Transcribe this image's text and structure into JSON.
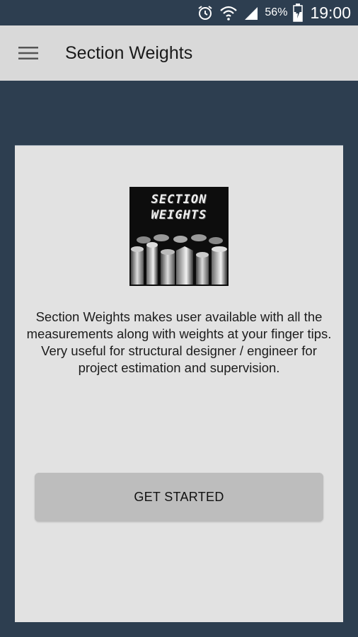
{
  "status_bar": {
    "battery_percent": "56%",
    "time": "19:00",
    "icons": [
      "alarm-icon",
      "wifi-icon",
      "signal-icon",
      "battery-charging-icon"
    ]
  },
  "app_bar": {
    "title": "Section Weights",
    "menu_icon": "hamburger-menu-icon"
  },
  "card": {
    "logo": {
      "line1": "SECTION",
      "line2": "WEIGHTS"
    },
    "description": "Section Weights makes user available with all the measurements along with weights at your finger tips. Very useful for structural designer / engineer for project estimation and supervision.",
    "button_label": "GET STARTED"
  },
  "colors": {
    "background": "#2d3e50",
    "app_bar": "#d9d9d9",
    "card": "#e2e2e2",
    "button": "#bdbdbd"
  }
}
